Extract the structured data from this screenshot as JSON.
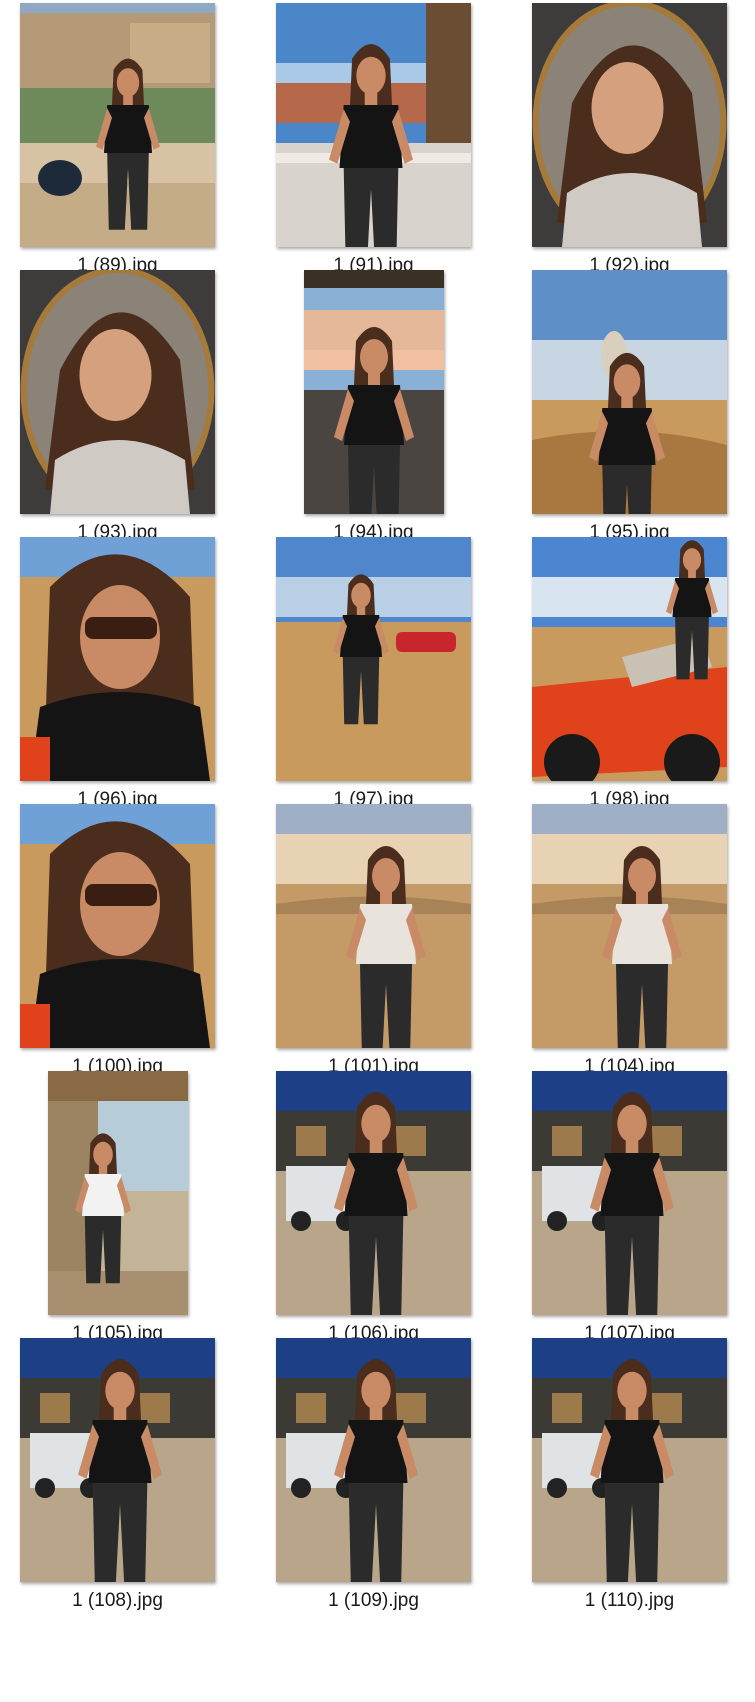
{
  "files": [
    {
      "name": "1 (89).jpg",
      "icon": "image-thumbnail",
      "scene": "resort-day"
    },
    {
      "name": "1 (91).jpg",
      "icon": "image-thumbnail",
      "scene": "balcony-day"
    },
    {
      "name": "1 (92).jpg",
      "icon": "image-thumbnail",
      "scene": "mirror-portrait"
    },
    {
      "name": "1 (93).jpg",
      "icon": "image-thumbnail",
      "scene": "mirror-portrait"
    },
    {
      "name": "1 (94).jpg",
      "icon": "image-thumbnail",
      "scene": "balcony-dusk"
    },
    {
      "name": "1 (95).jpg",
      "icon": "image-thumbnail",
      "scene": "desert-falcon"
    },
    {
      "name": "1 (96).jpg",
      "icon": "image-thumbnail",
      "scene": "desert-selfie"
    },
    {
      "name": "1 (97).jpg",
      "icon": "image-thumbnail",
      "scene": "desert-sitting"
    },
    {
      "name": "1 (98).jpg",
      "icon": "image-thumbnail",
      "scene": "desert-quad"
    },
    {
      "name": "1 (100).jpg",
      "icon": "image-thumbnail",
      "scene": "desert-selfie"
    },
    {
      "name": "1 (101).jpg",
      "icon": "image-thumbnail",
      "scene": "desert-sunset"
    },
    {
      "name": "1 (104).jpg",
      "icon": "image-thumbnail",
      "scene": "desert-sunset"
    },
    {
      "name": "1 (105).jpg",
      "icon": "image-thumbnail",
      "scene": "terrace-chair"
    },
    {
      "name": "1 (106).jpg",
      "icon": "image-thumbnail",
      "scene": "night-courtyard"
    },
    {
      "name": "1 (107).jpg",
      "icon": "image-thumbnail",
      "scene": "night-courtyard"
    },
    {
      "name": "1 (108).jpg",
      "icon": "image-thumbnail",
      "scene": "night-courtyard"
    },
    {
      "name": "1 (109).jpg",
      "icon": "image-thumbnail",
      "scene": "night-courtyard"
    },
    {
      "name": "1 (110).jpg",
      "icon": "image-thumbnail",
      "scene": "night-courtyard"
    }
  ],
  "colors": {
    "sky_day": "#4a86c8",
    "sky_light": "#a9c9e6",
    "sand": "#c99a5e",
    "sand_dark": "#a87840",
    "night_sky": "#1c3f86",
    "stone": "#b8a58a",
    "black_outfit": "#141414",
    "skin": "#c98a66",
    "hair": "#4a2d1c",
    "quad_red": "#e0431c",
    "frame_gold": "#a57a3a"
  }
}
